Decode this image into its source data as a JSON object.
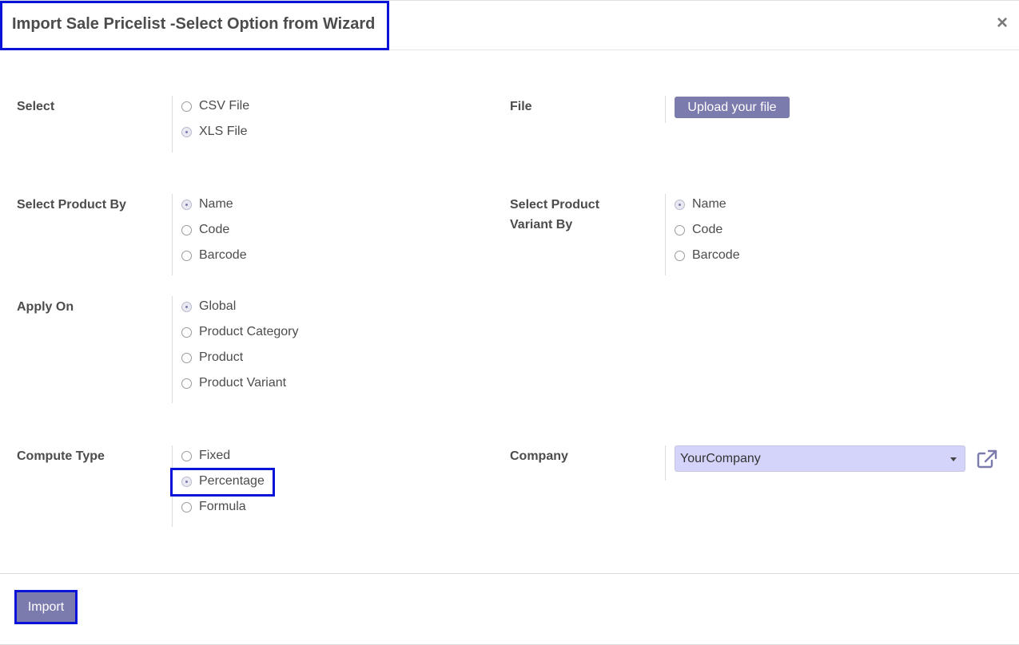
{
  "dialog": {
    "title": "Import Sale Pricelist -Select Option from Wizard",
    "close_label": "×"
  },
  "select": {
    "label": "Select",
    "options": [
      {
        "label": "CSV File",
        "checked": false
      },
      {
        "label": "XLS File",
        "checked": true
      }
    ]
  },
  "file": {
    "label": "File",
    "upload_label": "Upload your file"
  },
  "product_by": {
    "label": "Select Product By",
    "options": [
      {
        "label": "Name",
        "checked": true
      },
      {
        "label": "Code",
        "checked": false
      },
      {
        "label": "Barcode",
        "checked": false
      }
    ]
  },
  "variant_by": {
    "label_line1": "Select Product",
    "label_line2": "Variant By",
    "options": [
      {
        "label": "Name",
        "checked": true
      },
      {
        "label": "Code",
        "checked": false
      },
      {
        "label": "Barcode",
        "checked": false
      }
    ]
  },
  "apply_on": {
    "label": "Apply On",
    "options": [
      {
        "label": "Global",
        "checked": true
      },
      {
        "label": "Product Category",
        "checked": false
      },
      {
        "label": "Product",
        "checked": false
      },
      {
        "label": "Product Variant",
        "checked": false
      }
    ]
  },
  "compute_type": {
    "label": "Compute Type",
    "options": [
      {
        "label": "Fixed",
        "checked": false
      },
      {
        "label": "Percentage",
        "checked": true
      },
      {
        "label": "Formula",
        "checked": false
      }
    ]
  },
  "company": {
    "label": "Company",
    "value": "YourCompany"
  },
  "footer": {
    "import_label": "Import"
  },
  "colors": {
    "primary": "#7c7bad",
    "highlight_border": "#0a14d8",
    "select_bg": "#d4d4fb"
  },
  "icons": [
    "close-icon",
    "external-link-icon",
    "chevron-down-icon"
  ]
}
